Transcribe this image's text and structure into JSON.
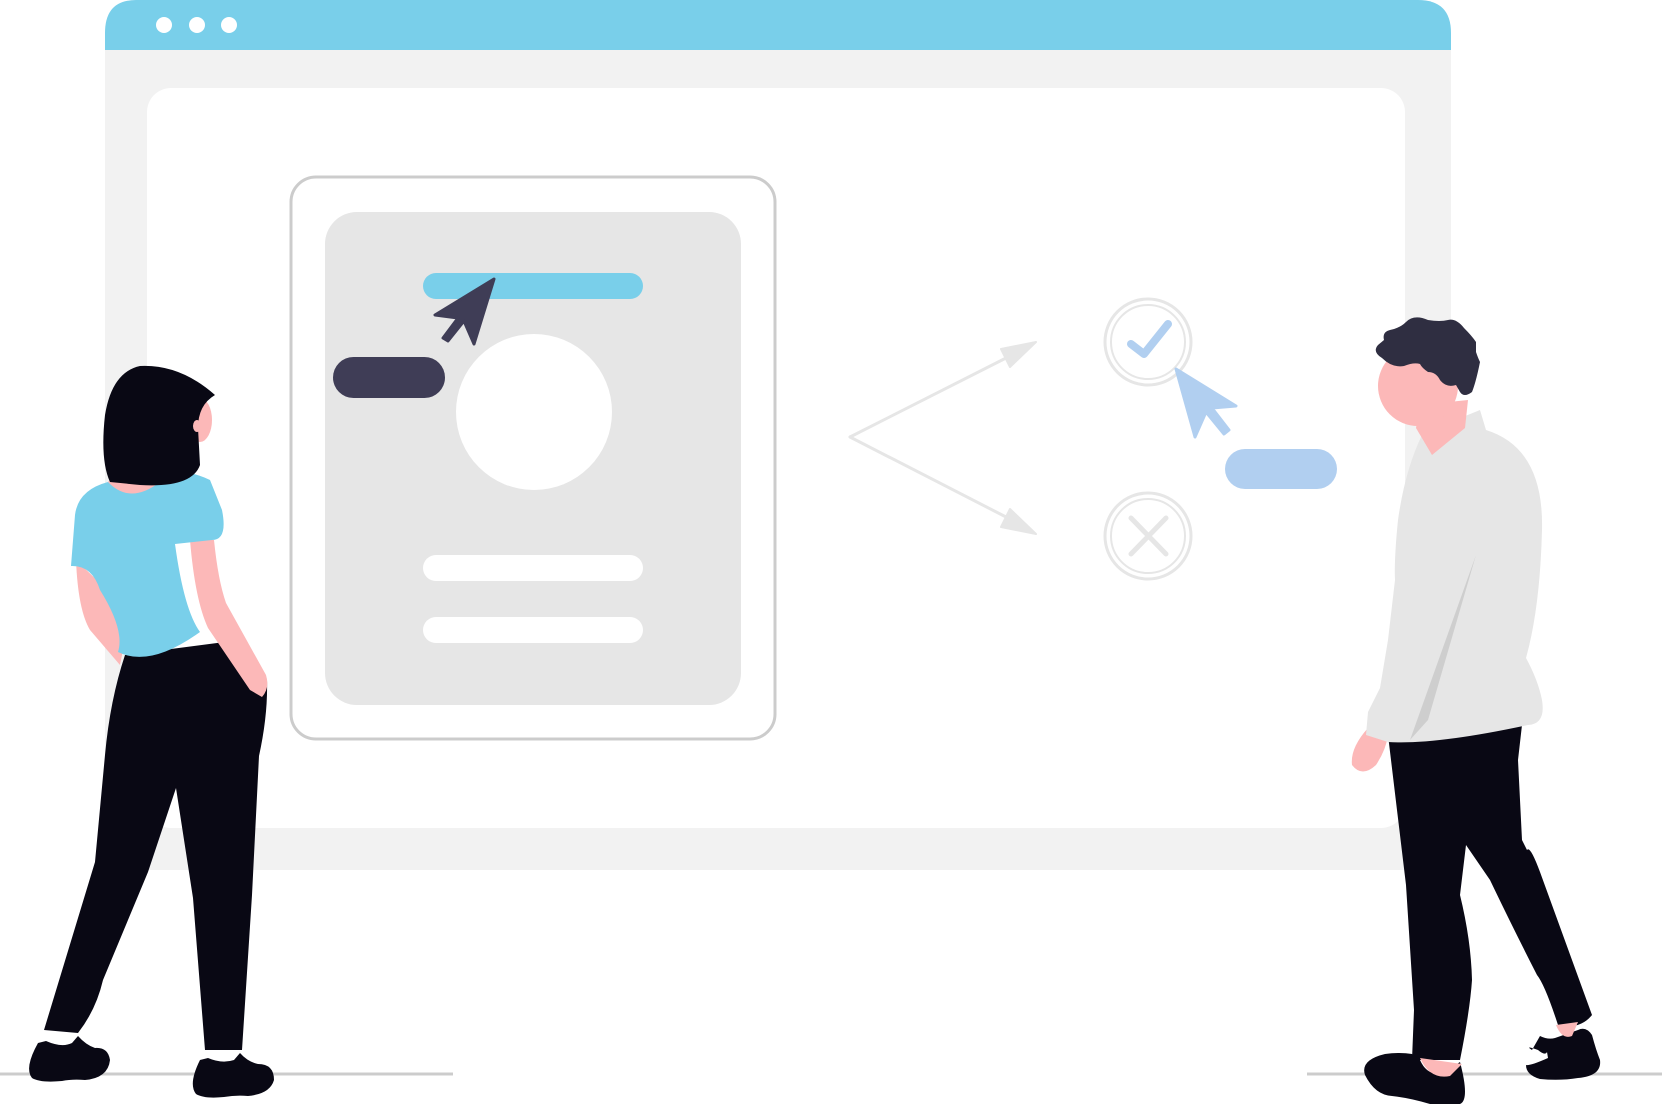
{
  "illustration": {
    "window_dots": [
      "dot-1",
      "dot-2",
      "dot-3"
    ],
    "colors": {
      "window_bar": "#79cfea",
      "window_body": "#f2f2f2",
      "window_content": "#ffffff",
      "card_inner": "#e6e6e6",
      "card_border": "#cccccc",
      "accent_bar": "#79cfea",
      "dark_button": "#3f3d56",
      "light_blue_button": "#b1cff0",
      "check_cursor": "#b1cff0",
      "branch_arrows": "#e6e6e6",
      "skin": "#fcb8b8",
      "hair": "#2f2e41",
      "pants": "#090814",
      "woman_shirt": "#79cfea",
      "man_shirt": "#e6e6e6",
      "ground_line": "#cccccc"
    },
    "icons": {
      "check": "check-icon",
      "cross": "cross-icon",
      "cursor_dark": "cursor-icon",
      "cursor_light": "cursor-icon"
    }
  }
}
